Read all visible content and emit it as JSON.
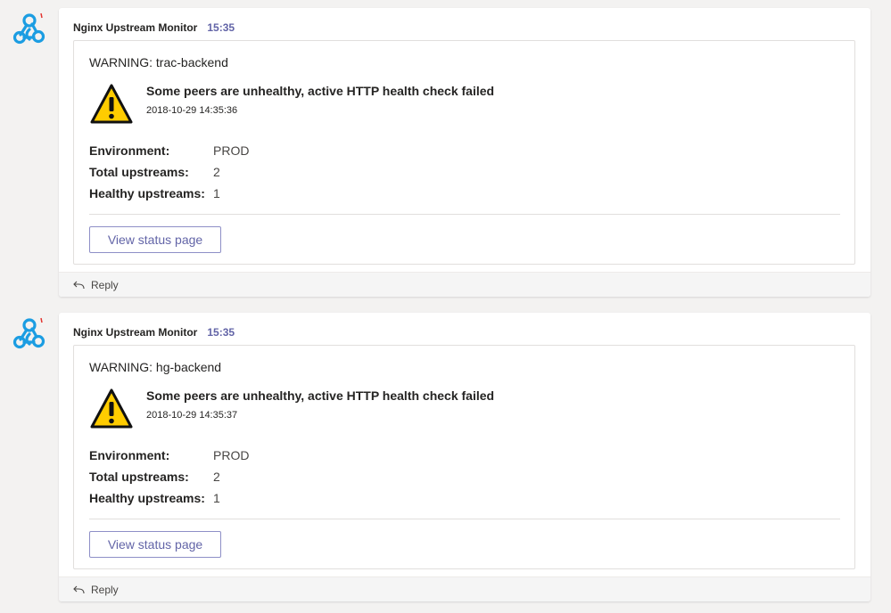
{
  "messages": [
    {
      "sender": "Nginx Upstream Monitor",
      "time": "15:35",
      "card_title": "WARNING: trac-backend",
      "icon": "warning-triangle-icon",
      "alert_title": "Some peers are unhealthy, active HTTP health check failed",
      "alert_time": "2018-10-29 14:35:36",
      "facts": [
        {
          "key": "Environment:",
          "value": "PROD"
        },
        {
          "key": "Total upstreams:",
          "value": "2"
        },
        {
          "key": "Healthy upstreams:",
          "value": "1"
        }
      ],
      "action_label": "View status page",
      "reply_label": "Reply"
    },
    {
      "sender": "Nginx Upstream Monitor",
      "time": "15:35",
      "card_title": "WARNING: hg-backend",
      "icon": "warning-triangle-icon",
      "alert_title": "Some peers are unhealthy, active HTTP health check failed",
      "alert_time": "2018-10-29 14:35:37",
      "facts": [
        {
          "key": "Environment:",
          "value": "PROD"
        },
        {
          "key": "Total upstreams:",
          "value": "2"
        },
        {
          "key": "Healthy upstreams:",
          "value": "1"
        }
      ],
      "action_label": "View status page",
      "reply_label": "Reply"
    }
  ],
  "colors": {
    "accent": "#6264a7",
    "background": "#f3f2f1",
    "avatar": "#1b9de2",
    "warning_fill": "#ffcc00"
  }
}
